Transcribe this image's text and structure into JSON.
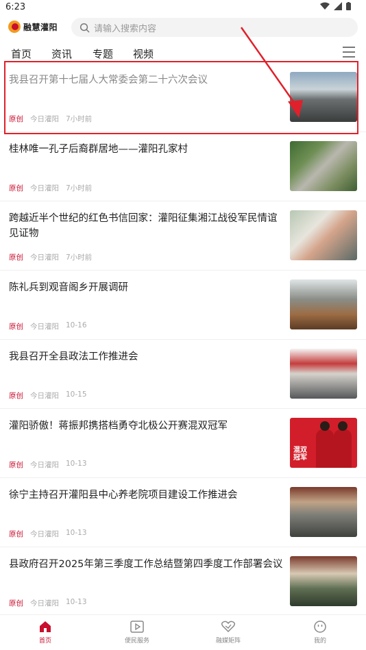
{
  "status": {
    "time": "6:23"
  },
  "header": {
    "app_name": "融慧灌阳",
    "search_placeholder": "请输入搜索内容"
  },
  "tabs": [
    {
      "label": "首页"
    },
    {
      "label": "资讯"
    },
    {
      "label": "专题"
    },
    {
      "label": "视频"
    }
  ],
  "articles": [
    {
      "title": "我县召开第十七届人大常委会第二十六次会议",
      "tag": "原创",
      "source": "今日灌阳",
      "time": "7小时前",
      "image": "meeting-photo"
    },
    {
      "title": "桂林唯一孔子后裔群居地——灌阳孔家村",
      "tag": "原创",
      "source": "今日灌阳",
      "time": "7小时前",
      "image": "village-aerial-photo"
    },
    {
      "title": "跨越近半个世纪的红色书信回家：灌阳征集湘江战役军民情谊见证物",
      "tag": "原创",
      "source": "今日灌阳",
      "time": "7小时前",
      "image": "letters-photo"
    },
    {
      "title": "陈礼兵到观音阁乡开展调研",
      "tag": "原创",
      "source": "今日灌阳",
      "time": "10-16",
      "image": "field-visit-photo"
    },
    {
      "title": "我县召开全县政法工作推进会",
      "tag": "原创",
      "source": "今日灌阳",
      "time": "10-15",
      "image": "meeting-photo"
    },
    {
      "title": "灌阳骄傲！蒋振邦携搭档勇夺北极公开赛混双冠军",
      "tag": "原创",
      "source": "今日灌阳",
      "time": "10-13",
      "image": "badminton-photo",
      "image_text": "混双\n冠军"
    },
    {
      "title": "徐宁主持召开灌阳县中心养老院项目建设工作推进会",
      "tag": "原创",
      "source": "今日灌阳",
      "time": "10-13",
      "image": "meeting-photo"
    },
    {
      "title": "县政府召开2025年第三季度工作总结暨第四季度工作部署会议",
      "tag": "原创",
      "source": "今日灌阳",
      "time": "10-13",
      "image": "meeting-photo"
    }
  ],
  "bottom_nav": [
    {
      "label": "首页",
      "icon": "home-icon",
      "active": true
    },
    {
      "label": "便民服务",
      "icon": "play-square-icon",
      "active": false
    },
    {
      "label": "融媒矩阵",
      "icon": "heart-link-icon",
      "active": false
    },
    {
      "label": "我的",
      "icon": "smiley-icon",
      "active": false
    }
  ],
  "colors": {
    "accent": "#c8102e",
    "highlight_box": "#e0202a"
  }
}
